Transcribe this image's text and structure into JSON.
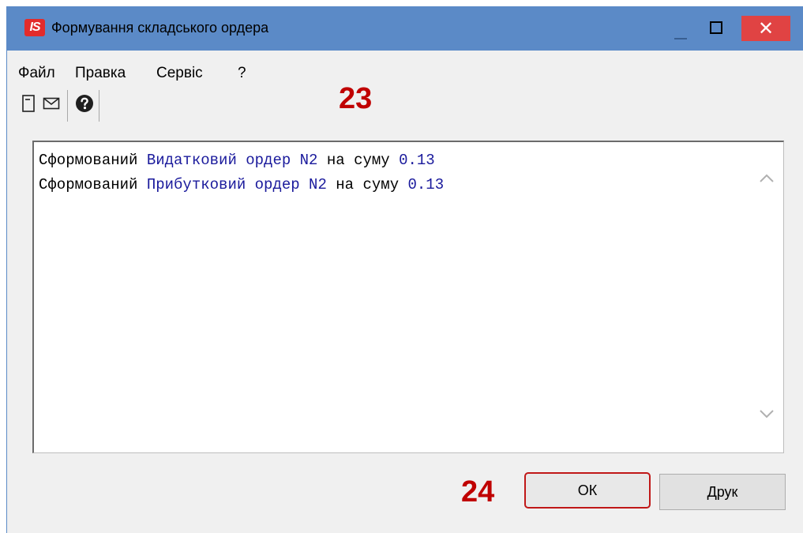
{
  "window": {
    "title": "Формування складського ордера",
    "logo_text": "IS",
    "close_glyph": "✕",
    "accent_color": "#5b8ac7",
    "close_color": "#e04343"
  },
  "menu": {
    "items": [
      "Файл",
      "Правка",
      "Сервіс",
      "?"
    ]
  },
  "toolbar": {
    "icons": [
      "document-icon",
      "envelope-icon",
      "help-icon"
    ]
  },
  "annotations": {
    "step_toolbar": "23",
    "step_ok": "24",
    "annotation_color": "#c00000"
  },
  "log": {
    "lines": [
      {
        "prefix": "Сформований ",
        "doc": "Видатковий ордер N2",
        "mid": " на суму ",
        "amount": "0.13"
      },
      {
        "prefix": "Сформований ",
        "doc": "Прибутковий ордер N2",
        "mid": " на суму ",
        "amount": "0.13"
      }
    ]
  },
  "buttons": {
    "ok_label": "ОК",
    "print_label": "Друк"
  }
}
